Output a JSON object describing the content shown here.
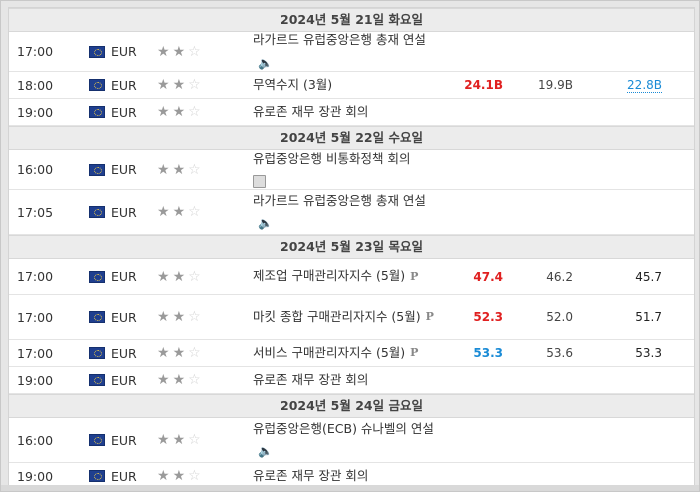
{
  "days": [
    {
      "header": "2024년 5월 21일 화요일",
      "rows": [
        {
          "time": "17:00",
          "currency": "EUR",
          "stars": 2,
          "event": "라가르드 유럽중앙은행 총재 연설",
          "icon": "sound-icon",
          "actual": "",
          "forecast": "",
          "previous": ""
        },
        {
          "time": "18:00",
          "currency": "EUR",
          "stars": 2,
          "event": "무역수지 (3월)",
          "icon": "",
          "actual": "24.1B",
          "actual_color": "red",
          "forecast": "19.9B",
          "previous": "22.8B",
          "previous_link": true
        },
        {
          "time": "19:00",
          "currency": "EUR",
          "stars": 2,
          "event": "유로존 재무 장관 회의",
          "icon": "",
          "actual": "",
          "forecast": "",
          "previous": ""
        }
      ]
    },
    {
      "header": "2024년 5월 22일 수요일",
      "rows": [
        {
          "time": "16:00",
          "currency": "EUR",
          "stars": 2,
          "event": "유럽중앙은행 비통화정책 회의",
          "icon": "document-icon",
          "actual": "",
          "forecast": "",
          "previous": ""
        },
        {
          "time": "17:05",
          "currency": "EUR",
          "stars": 2,
          "event": "라가르드 유럽중앙은행 총재 연설",
          "icon": "sound-icon",
          "actual": "",
          "forecast": "",
          "previous": ""
        }
      ]
    },
    {
      "header": "2024년 5월 23일 목요일",
      "rows": [
        {
          "time": "17:00",
          "currency": "EUR",
          "stars": 2,
          "event": "제조업 구매관리자지수 (5월)",
          "icon": "preliminary-icon",
          "actual": "47.4",
          "actual_color": "red",
          "forecast": "46.2",
          "previous": "45.7"
        },
        {
          "time": "17:00",
          "currency": "EUR",
          "stars": 2,
          "event": "마킷 종합 구매관리자지수 (5월)",
          "icon": "preliminary-icon",
          "actual": "52.3",
          "actual_color": "red",
          "forecast": "52.0",
          "previous": "51.7"
        },
        {
          "time": "17:00",
          "currency": "EUR",
          "stars": 2,
          "event": "서비스 구매관리자지수 (5월)",
          "icon": "preliminary-icon",
          "actual": "53.3",
          "actual_color": "blue",
          "forecast": "53.6",
          "previous": "53.3"
        },
        {
          "time": "19:00",
          "currency": "EUR",
          "stars": 2,
          "event": "유로존 재무 장관 회의",
          "icon": "",
          "actual": "",
          "forecast": "",
          "previous": ""
        }
      ]
    },
    {
      "header": "2024년 5월 24일 금요일",
      "rows": [
        {
          "time": "16:00",
          "currency": "EUR",
          "stars": 2,
          "event": "유럽중앙은행(ECB) 슈나벨의 연설",
          "icon": "sound-icon",
          "actual": "",
          "forecast": "",
          "previous": ""
        },
        {
          "time": "19:00",
          "currency": "EUR",
          "stars": 2,
          "event": "유로존 재무 장관 회의",
          "icon": "",
          "actual": "",
          "forecast": "",
          "previous": ""
        }
      ]
    }
  ],
  "colors": {
    "red": "#e02020",
    "blue": "#1a8bd6"
  }
}
